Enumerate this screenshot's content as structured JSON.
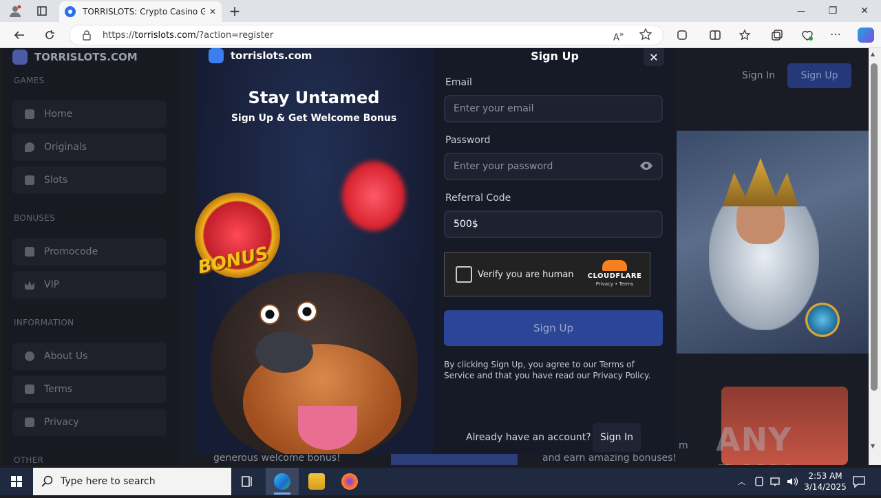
{
  "browser": {
    "tab_title": "TORRISLOTS: Crypto Casino Gam",
    "url_prefix": "https://",
    "url_host": "torrislots.com",
    "url_path": "/?action=register",
    "new_tab": "+",
    "close_tab": "✕",
    "minimize": "—",
    "restore": "❐",
    "close_window": "✕"
  },
  "site": {
    "brand": "TORRISLOTS.COM",
    "sections": [
      "GAMES",
      "BONUSES",
      "INFORMATION",
      "OTHER"
    ],
    "nav": {
      "games": [
        "Home",
        "Originals",
        "Slots"
      ],
      "bonuses": [
        "Promocode",
        "VIP"
      ],
      "information": [
        "About Us",
        "Terms",
        "Privacy"
      ]
    },
    "top_signin": "Sign In",
    "top_signup": "Sign Up",
    "bottom_text_left": "generous welcome bonus!",
    "bottom_text_right": "and earn amazing bonuses!",
    "bottom_text_fragment": "m"
  },
  "modal": {
    "brand": "torrislots.com",
    "promo_title": "Stay Untamed",
    "promo_subtitle": "Sign Up & Get Welcome Bonus",
    "bonus_badge": "BONUS",
    "heading": "Sign Up",
    "close": "✕",
    "email_label": "Email",
    "email_placeholder": "Enter your email",
    "password_label": "Password",
    "password_placeholder": "Enter your password",
    "referral_label": "Referral Code",
    "referral_value": "500$",
    "captcha_text": "Verify you are human",
    "captcha_brand": "CLOUDFLARE",
    "captcha_links": "Privacy • Terms",
    "submit": "Sign Up",
    "legal": "By clicking Sign Up, you agree to our Terms of Service and that you have read our Privacy Policy.",
    "already": "Already have an account?",
    "signin": "Sign In"
  },
  "watermark": "ANY RUN",
  "taskbar": {
    "search_placeholder": "Type here to search",
    "time": "2:53 AM",
    "date": "3/14/2025"
  }
}
